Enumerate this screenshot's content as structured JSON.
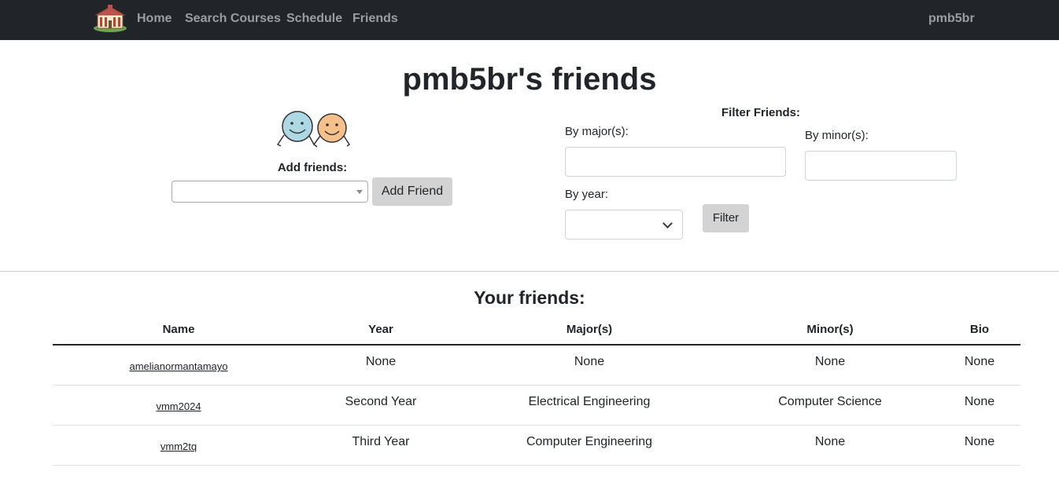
{
  "navbar": {
    "links": [
      "Home",
      "Search Courses",
      "Schedule",
      "Friends"
    ],
    "user": "pmb5br",
    "logo_icon": "university-building-icon",
    "background": "#212529"
  },
  "page": {
    "title": "pmb5br's friends"
  },
  "add_friends": {
    "icon": "two-smiley-friends-icon",
    "label": "Add friends:",
    "select_value": "",
    "button": "Add Friend"
  },
  "filter": {
    "title": "Filter Friends:",
    "major_label": "By major(s):",
    "major_value": "",
    "minor_label": "By minor(s):",
    "minor_value": "",
    "year_label": "By year:",
    "year_value": "",
    "button": "Filter"
  },
  "friends_table": {
    "title": "Your friends:",
    "headers": [
      "Name",
      "Year",
      "Major(s)",
      "Minor(s)",
      "Bio"
    ],
    "rows": [
      {
        "name": "amelianormantamayo",
        "year": "None",
        "major": "None",
        "minor": "None",
        "bio": "None"
      },
      {
        "name": "vmm2024",
        "year": "Second Year",
        "major": "Electrical Engineering",
        "minor": "Computer Science",
        "bio": "None"
      },
      {
        "name": "vmm2tq",
        "year": "Third Year",
        "major": "Computer Engineering",
        "minor": "None",
        "bio": "None"
      }
    ]
  }
}
